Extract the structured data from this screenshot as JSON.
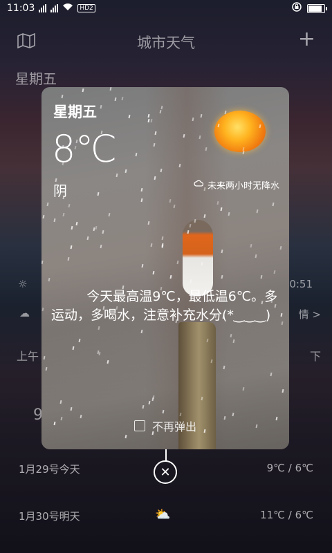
{
  "status_bar": {
    "time": "11:03",
    "network": "HD2"
  },
  "header": {
    "title": "城市天气",
    "add_label": "+"
  },
  "background": {
    "weekday": "星期五",
    "row_partial_left": "上午",
    "row_partial_right": "下",
    "partial_time": "0:51",
    "partial_detail": "情 >",
    "partial_num": "9"
  },
  "card": {
    "weekday": "星期五",
    "temperature": "8℃",
    "condition": "阴",
    "rain_note": "未来两小时无降水",
    "message": "今天最高温9℃，最低温6℃。多运动，多喝水，注意补充水分(*‿‿‿)",
    "dont_show": "不再弹出"
  },
  "forecast": [
    {
      "date": "1月29号今天",
      "temps": "9℃ / 6℃"
    },
    {
      "date": "1月30号明天",
      "temps": "11℃ / 6℃"
    }
  ],
  "icons": [
    "map-icon",
    "add-icon",
    "rain-cloud-icon",
    "close-icon",
    "sun-icon"
  ]
}
